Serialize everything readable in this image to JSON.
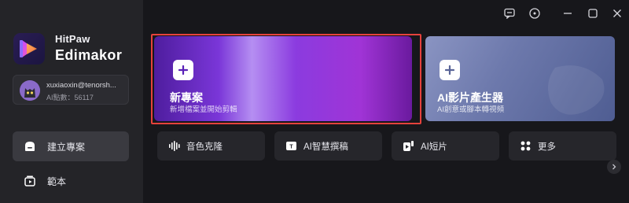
{
  "brand": {
    "line1": "HitPaw",
    "line2": "Edimakor"
  },
  "user": {
    "email": "xuxiaoxin@tenorsh...",
    "points": "AI點數：56117"
  },
  "nav": [
    {
      "label": "建立專案",
      "icon": "create-project-icon",
      "active": true
    },
    {
      "label": "範本",
      "icon": "template-icon",
      "active": false
    }
  ],
  "titlebar": {
    "icons": [
      "feedback-icon",
      "info-icon",
      "minimize-icon",
      "maximize-icon",
      "close-icon"
    ]
  },
  "cards": {
    "new_project": {
      "title": "新專案",
      "subtitle": "新增檔案並開始剪輯"
    },
    "ai_generator": {
      "title": "AI影片產生器",
      "subtitle": "AI創意或腳本轉視頻"
    }
  },
  "tools": [
    {
      "label": "音色克隆",
      "icon": "voice-clone-icon"
    },
    {
      "label": "AI智慧撰稿",
      "icon": "ai-copywriting-icon"
    },
    {
      "label": "AI短片",
      "icon": "ai-short-video-icon"
    },
    {
      "label": "更多",
      "icon": "more-icon"
    }
  ],
  "colors": {
    "highlight": "#e5423c",
    "sidebar": "#242428",
    "background": "#17171b"
  }
}
